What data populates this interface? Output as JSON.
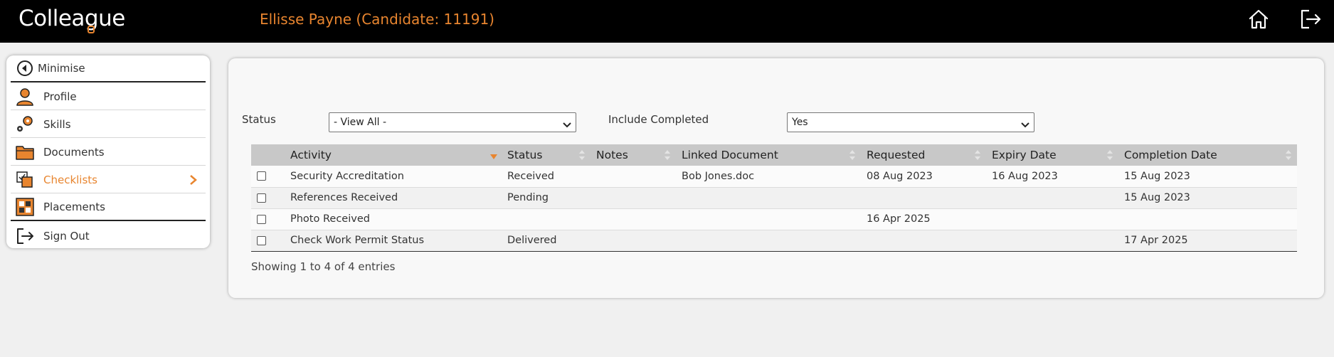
{
  "header": {
    "logo_text": "Colleague",
    "candidate_title": "Ellisse Payne (Candidate: 11191)",
    "icons": [
      "home-icon",
      "logout-icon"
    ]
  },
  "sidebar": {
    "items": [
      {
        "label": "Minimise",
        "icon": "back-circle-icon"
      },
      {
        "label": "Profile",
        "icon": "person-icon"
      },
      {
        "label": "Skills",
        "icon": "gears-icon"
      },
      {
        "label": "Documents",
        "icon": "folder-icon"
      },
      {
        "label": "Checklists",
        "icon": "checklist-icon",
        "active": true
      },
      {
        "label": "Placements",
        "icon": "placements-icon"
      },
      {
        "label": "Sign Out",
        "icon": "sign-out-icon"
      }
    ]
  },
  "filters": {
    "status_label": "Status",
    "status_value": "- View All -",
    "include_completed_label": "Include Completed",
    "include_completed_value": "Yes"
  },
  "table": {
    "columns": [
      "",
      "Activity",
      "Status",
      "Notes",
      "Linked Document",
      "Requested",
      "Expiry Date",
      "Completion Date"
    ],
    "rows": [
      [
        "",
        "Security Accreditation",
        "Received",
        "",
        "Bob Jones.doc",
        "08 Aug 2023",
        "16 Aug 2023",
        "15 Aug 2023"
      ],
      [
        "",
        "References Received",
        "Pending",
        "",
        "",
        "",
        "",
        "15 Aug 2023"
      ],
      [
        "",
        "Photo Received",
        "",
        "",
        "",
        "16 Apr 2025",
        "",
        ""
      ],
      [
        "",
        "Check Work Permit Status",
        "Delivered",
        "",
        "",
        "",
        "",
        "17 Apr 2025"
      ]
    ],
    "footer": "Showing 1 to 4 of 4 entries"
  },
  "colors": {
    "accent": "#e8852f",
    "header_bg": "#000000",
    "table_header_bg": "#c8c8c8"
  }
}
